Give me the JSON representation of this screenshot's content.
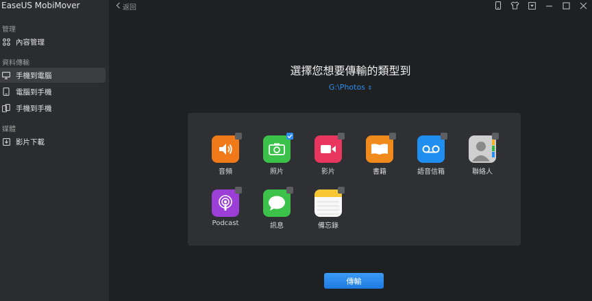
{
  "app": {
    "title": "EaseUS MobiMover"
  },
  "sidebar": {
    "sections": [
      {
        "label": "管理"
      },
      {
        "label": "資料傳輸"
      },
      {
        "label": "媒體"
      }
    ],
    "items": [
      {
        "label": "內容管理",
        "icon": "grid-icon"
      },
      {
        "label": "手機到電腦",
        "icon": "phone-to-pc-icon",
        "active": true
      },
      {
        "label": "電腦到手機",
        "icon": "pc-to-phone-icon"
      },
      {
        "label": "手機到手機",
        "icon": "phone-to-phone-icon"
      },
      {
        "label": "影片下載",
        "icon": "download-icon"
      }
    ]
  },
  "topbar": {
    "back_label": "返回",
    "icons": [
      "phone-icon",
      "shirt-icon",
      "dropdown-icon",
      "minimize-icon",
      "maximize-icon",
      "close-icon"
    ]
  },
  "main": {
    "heading": "選擇您想要傳輸的類型到",
    "destination": "G:\\Photos",
    "categories": [
      {
        "label": "音頻",
        "icon": "speaker-icon",
        "color": "#f07a1a",
        "checked": false
      },
      {
        "label": "照片",
        "icon": "camera-icon",
        "color": "#3cc24a",
        "checked": true
      },
      {
        "label": "影片",
        "icon": "video-icon",
        "color": "#e8365e",
        "checked": false
      },
      {
        "label": "書籍",
        "icon": "book-icon",
        "color": "#f08a1c",
        "checked": false
      },
      {
        "label": "語音信箱",
        "icon": "voicemail-icon",
        "color": "#1f8ef0",
        "checked": false
      },
      {
        "label": "聯絡人",
        "icon": "contact-icon",
        "color": "#cfcfcf",
        "checked": false
      },
      {
        "label": "Podcast",
        "icon": "podcast-icon",
        "color": "#9b3fd6",
        "checked": false
      },
      {
        "label": "訊息",
        "icon": "message-icon",
        "color": "#3cc24a",
        "checked": false
      },
      {
        "label": "備忘錄",
        "icon": "notes-icon",
        "color": "#f8f8f8",
        "checked": false
      }
    ],
    "transfer_label": "傳輸"
  },
  "colors": {
    "accent": "#2d8ef0",
    "sidebar": "#2b2c2e",
    "background": "#1f2022",
    "panel": "#2f3033"
  }
}
